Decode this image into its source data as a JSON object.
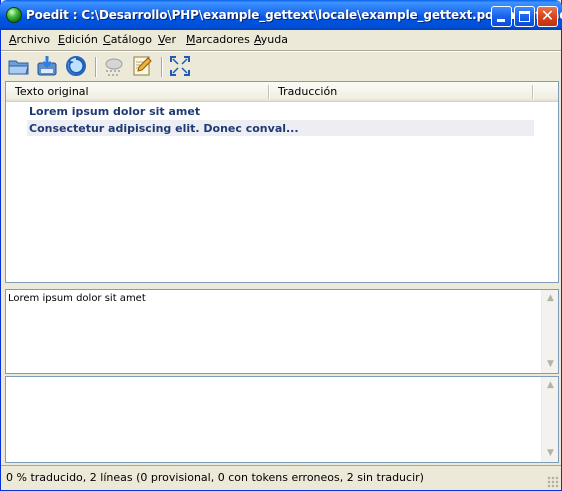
{
  "window": {
    "title": "Poedit : C:\\Desarrollo\\PHP\\example_gettext\\locale\\example_gettext.po (modificado)"
  },
  "menu": {
    "items": [
      {
        "label": "Archivo",
        "mnemonic": "A",
        "rest": "rchivo"
      },
      {
        "label": "Edición",
        "mnemonic": "E",
        "rest": "dición"
      },
      {
        "label": "Catálogo",
        "mnemonic": "C",
        "rest": "atálogo"
      },
      {
        "label": "Ver",
        "mnemonic": "V",
        "rest": "er"
      },
      {
        "label": "Marcadores",
        "mnemonic": "M",
        "rest": "arcadores"
      },
      {
        "label": "Ayuda",
        "mnemonic": "A",
        "rest": "yuda"
      }
    ]
  },
  "toolbar": {
    "buttons": [
      "open-folder-icon",
      "save-icon",
      "update-catalog-icon",
      "validate-icon",
      "edit-comment-icon",
      "fullscreen-icon"
    ]
  },
  "list": {
    "columns": [
      "Texto original",
      "Traducción"
    ],
    "rows": [
      {
        "original": "Lorem ipsum dolor sit amet",
        "translation": ""
      },
      {
        "original": "Consectetur adipiscing elit. Donec conval...",
        "translation": ""
      }
    ]
  },
  "source_pane": {
    "text": "Lorem ipsum dolor sit amet"
  },
  "translation_pane": {
    "text": ""
  },
  "status": {
    "text": "0 % traducido, 2 líneas (0 provisional, 0 con tokens erroneos, 2 sin traducir)"
  }
}
